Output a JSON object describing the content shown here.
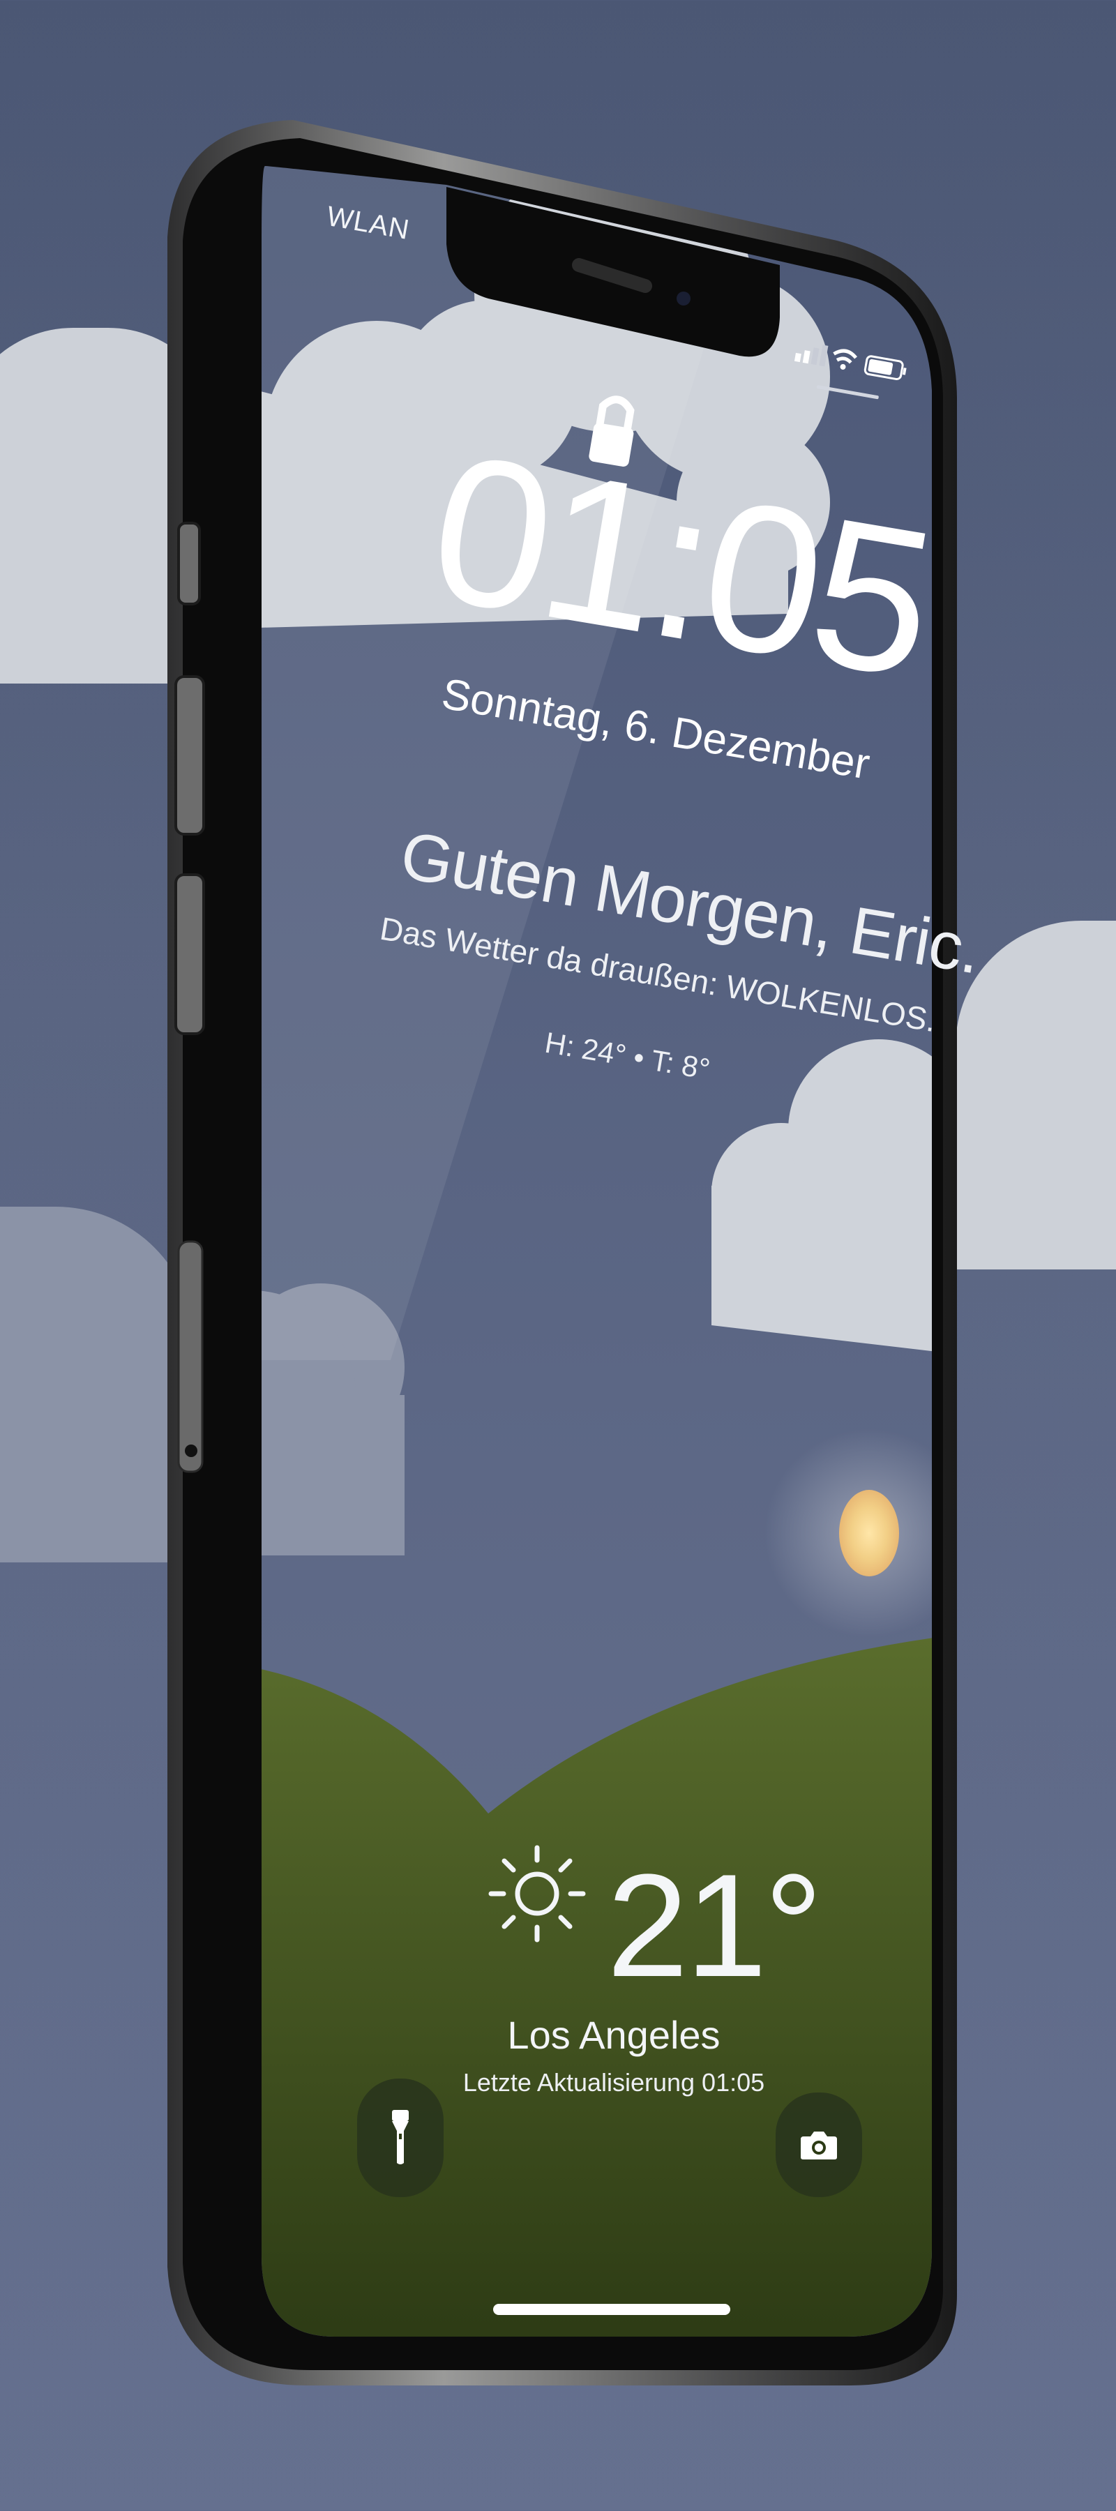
{
  "status_bar": {
    "network_label": "WLAN",
    "battery_icon": "battery-icon",
    "wifi_icon": "wifi-icon",
    "signal_icon": "cellular-signal-icon"
  },
  "lock_screen": {
    "lock_icon": "lock-icon",
    "time": "01:05",
    "date": "Sonntag, 6. Dezember",
    "greeting": "Guten Morgen, Eric.",
    "weather_summary": "Das Wetter da draußen: WOLKENLOS.",
    "high_low": "H: 24° • T: 8°"
  },
  "weather_widget": {
    "icon": "sun-icon",
    "temperature": "21°",
    "city": "Los Angeles",
    "last_update": "Letzte Aktualisierung 01:05"
  },
  "quick_actions": [
    {
      "name": "flashlight",
      "icon": "flashlight-icon"
    },
    {
      "name": "camera",
      "icon": "camera-icon"
    }
  ],
  "colors": {
    "background": "#4b5774",
    "sky": "#5a6683",
    "hill": "#4f6426",
    "cloud": "#cdd1d8",
    "sun": "#f3d99a"
  }
}
